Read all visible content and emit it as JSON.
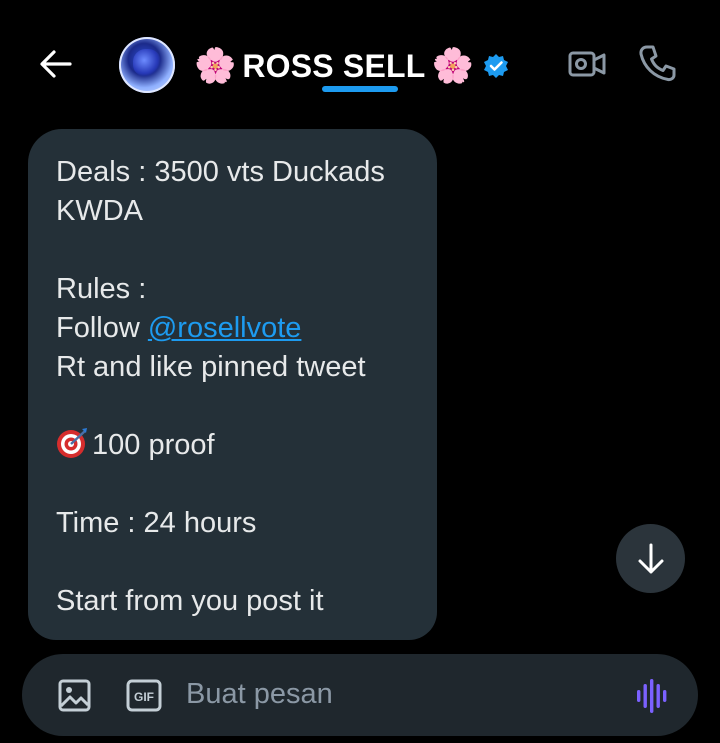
{
  "header": {
    "title": "ROSS SELL",
    "title_emoji_left": "🌸",
    "title_emoji_right": "🌸",
    "icons": [
      "back-arrow-icon",
      "avatar",
      "verified-badge-icon",
      "video-call-icon",
      "phone-icon"
    ]
  },
  "message": {
    "lines": [
      "Deals : 3500 vts Duckads",
      "KWDA",
      "",
      "Rules :",
      "Follow ",
      "Rt and like pinned tweet",
      "",
      "100 proof",
      "",
      "Time : 24 hours",
      "",
      "Start from you post it"
    ],
    "mention": "@rosellvote"
  },
  "composer": {
    "placeholder": "Buat pesan",
    "icons": [
      "image-icon",
      "gif-icon",
      "voice-message-icon"
    ]
  },
  "colors": {
    "background": "#000000",
    "bubble": "#243038",
    "composer": "#1f272d",
    "accent": "#1d9bf0",
    "voice_purple": "#7b61ff"
  }
}
